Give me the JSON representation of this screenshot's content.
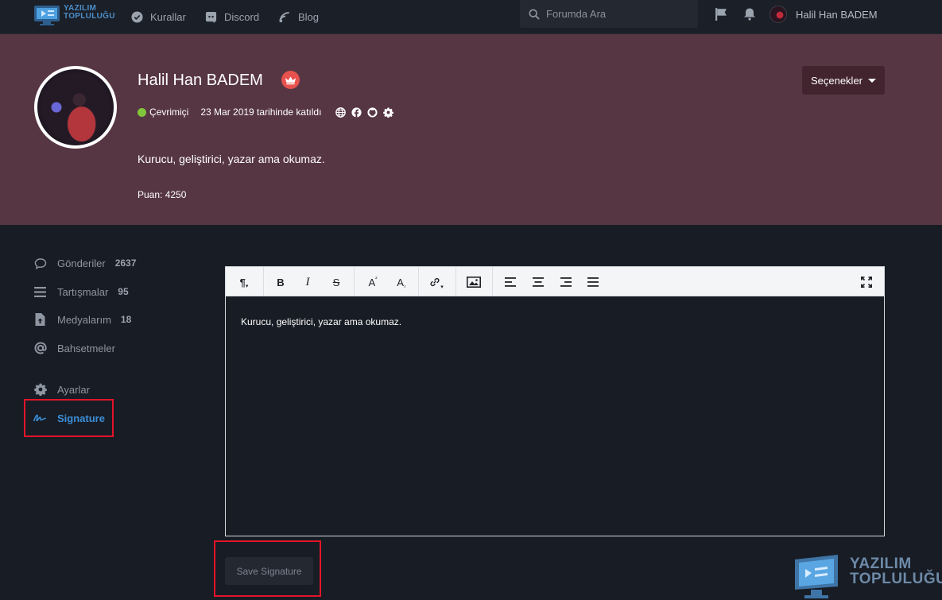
{
  "logo": {
    "line1": "YAZILIM",
    "line2": "TOPLULUĞU"
  },
  "nav": {
    "links": [
      {
        "label": "Kurallar",
        "icon": "check-circle-icon"
      },
      {
        "label": "Discord",
        "icon": "discord-icon"
      },
      {
        "label": "Blog",
        "icon": "blog-icon"
      }
    ],
    "search_placeholder": "Forumda Ara",
    "user_name": "Halil Han BADEM"
  },
  "profile": {
    "name": "Halil Han BADEM",
    "status": "Çevrimiçi",
    "joined": "23 Mar 2019 tarihinde katıldı",
    "bio": "Kurucu, geliştirici, yazar ama okumaz.",
    "points": "Puan: 4250",
    "options_label": "Seçenekler",
    "colors": {
      "hero_bg": "#573644",
      "online": "#7fc63a",
      "badge": "#e8524e"
    }
  },
  "sidebar": {
    "items": [
      {
        "label": "Gönderiler",
        "count": "2637",
        "icon": "comment-icon"
      },
      {
        "label": "Tartışmalar",
        "count": "95",
        "icon": "list-icon"
      },
      {
        "label": "Medyalarım",
        "count": "18",
        "icon": "file-upload-icon"
      },
      {
        "label": "Bahsetmeler",
        "count": "",
        "icon": "at-icon"
      },
      {
        "label": "Ayarlar",
        "count": "",
        "icon": "gear-icon"
      },
      {
        "label": "Signature",
        "count": "",
        "icon": "signature-icon",
        "active": true
      }
    ],
    "accent": "#3b8fd8"
  },
  "editor": {
    "content": "Kurucu, geliştirici, yazar ama okumaz.",
    "toolbar": [
      "paragraph-icon",
      "bold-icon",
      "italic-icon",
      "strikethrough-icon",
      "superscript-icon",
      "subscript-icon",
      "link-icon",
      "image-icon",
      "align-left-icon",
      "align-center-icon",
      "align-right-icon",
      "align-justify-icon",
      "fullscreen-icon"
    ]
  },
  "save_label": "Save Signature",
  "watermark": {
    "line1": "YAZILIM",
    "line2": "TOPLULUĞU"
  }
}
